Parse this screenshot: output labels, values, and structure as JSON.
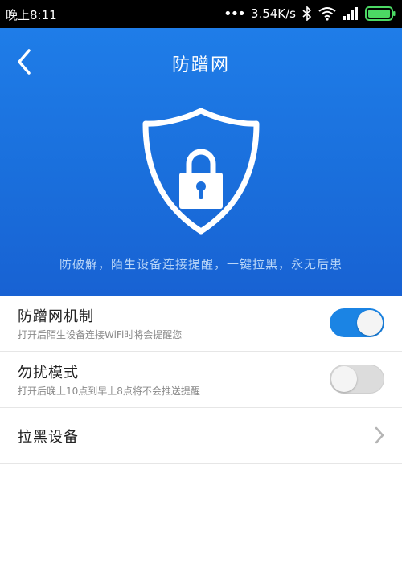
{
  "status_bar": {
    "time": "晚上8:11",
    "speed": "3.54K/s"
  },
  "header": {
    "title": "防蹭网"
  },
  "hero": {
    "tagline": "防破解，陌生设备连接提醒，一键拉黑，永无后患"
  },
  "settings": [
    {
      "label": "防蹭网机制",
      "desc": "打开后陌生设备连接WiFi时将会提醒您",
      "toggle": "on"
    },
    {
      "label": "勿扰模式",
      "desc": "打开后晚上10点到早上8点将不会推送提醒",
      "toggle": "off"
    },
    {
      "label": "拉黑设备"
    }
  ],
  "colors": {
    "accent": "#1b84e4",
    "hero_top": "#1f7de8",
    "hero_bottom": "#1862d3"
  },
  "icons": [
    "back-arrow-icon",
    "shield-lock-icon",
    "chevron-right-icon",
    "wifi-icon",
    "bluetooth-icon",
    "signal-icon",
    "battery-icon"
  ]
}
